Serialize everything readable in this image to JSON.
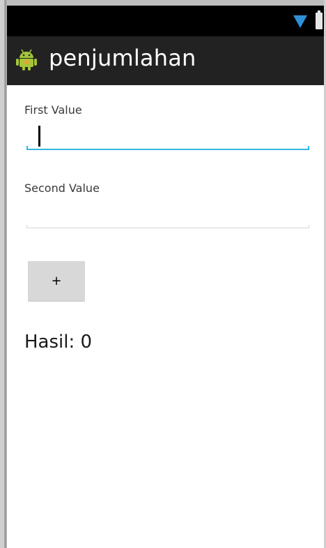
{
  "app": {
    "title": "penjumlahan",
    "icon": "android-robot-icon"
  },
  "status_bar": {
    "icons": [
      "wifi-icon",
      "battery-icon"
    ],
    "colors": {
      "wifi": "#2f8fd8",
      "background": "#000000"
    }
  },
  "form": {
    "first_label": "First Value",
    "first_value": "",
    "second_label": "Second Value",
    "second_value": "",
    "add_button_label": "+",
    "result_text": "Hasil: 0"
  },
  "theme": {
    "action_bar_color": "#222222",
    "accent_color": "#33b5e5",
    "button_color": "#d8d8d8"
  }
}
